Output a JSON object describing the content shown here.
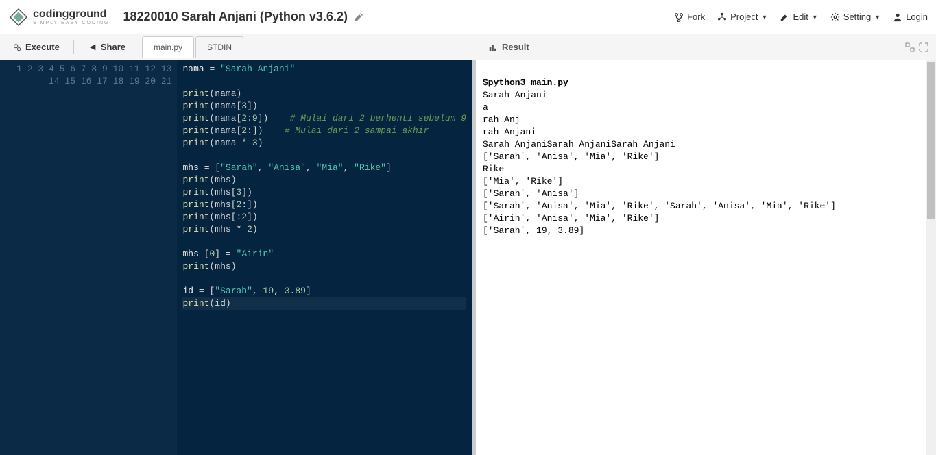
{
  "header": {
    "logo_main": "codingground",
    "logo_sub": "SIMPLY EASY CODING",
    "title": "18220010 Sarah Anjani (Python v3.6.2)"
  },
  "menu": {
    "fork": "Fork",
    "project": "Project",
    "edit": "Edit",
    "setting": "Setting",
    "login": "Login"
  },
  "toolbar": {
    "execute": "Execute",
    "share": "Share",
    "tab_main": "main.py",
    "tab_stdin": "STDIN",
    "result": "Result"
  },
  "editor": {
    "lines": [
      1,
      2,
      3,
      4,
      5,
      6,
      7,
      8,
      9,
      10,
      11,
      12,
      13,
      14,
      15,
      16,
      17,
      18,
      19,
      20,
      21
    ]
  },
  "code_tokens": {
    "l1": {
      "a": "nama ",
      "b": "=",
      "c": " \"Sarah Anjani\""
    },
    "l3": {
      "a": "print",
      "b": "(nama)"
    },
    "l4": {
      "a": "print",
      "b": "(nama[",
      "c": "3",
      "d": "])"
    },
    "l5": {
      "a": "print",
      "b": "(nama[",
      "c": "2",
      "d": ":",
      "e": "9",
      "f": "])    ",
      "g": "# Mulai dari 2 berhenti sebelum 9"
    },
    "l6": {
      "a": "print",
      "b": "(nama[",
      "c": "2",
      "d": ":])    ",
      "g": "# Mulai dari 2 sampai akhir"
    },
    "l7": {
      "a": "print",
      "b": "(nama * ",
      "c": "3",
      "d": ")"
    },
    "l9": {
      "a": "mhs ",
      "b": "=",
      "c": " [",
      "d": "\"Sarah\"",
      "e": ", ",
      "f": "\"Anisa\"",
      "g": ", ",
      "h": "\"Mia\"",
      "i": ", ",
      "j": "\"Rike\"",
      "k": "]"
    },
    "l10": {
      "a": "print",
      "b": "(mhs)"
    },
    "l11": {
      "a": "print",
      "b": "(mhs[",
      "c": "3",
      "d": "])"
    },
    "l12": {
      "a": "print",
      "b": "(mhs[",
      "c": "2",
      "d": ":])"
    },
    "l13": {
      "a": "print",
      "b": "(mhs[:",
      "c": "2",
      "d": "])"
    },
    "l14": {
      "a": "print",
      "b": "(mhs * ",
      "c": "2",
      "d": ")"
    },
    "l16": {
      "a": "mhs [",
      "b": "0",
      "c": "] ",
      "d": "=",
      "e": " \"Airin\""
    },
    "l17": {
      "a": "print",
      "b": "(mhs)"
    },
    "l19": {
      "a": "id ",
      "b": "=",
      "c": " [",
      "d": "\"Sarah\"",
      "e": ", ",
      "f": "19",
      "g": ", ",
      "h": "3.89",
      "i": "]"
    },
    "l20": {
      "a": "print",
      "b": "(id)"
    }
  },
  "console": {
    "cmd": "$python3 main.py",
    "out": "Sarah Anjani\na\nrah Anj\nrah Anjani\nSarah AnjaniSarah AnjaniSarah Anjani\n['Sarah', 'Anisa', 'Mia', 'Rike']\nRike\n['Mia', 'Rike']\n['Sarah', 'Anisa']\n['Sarah', 'Anisa', 'Mia', 'Rike', 'Sarah', 'Anisa', 'Mia', 'Rike']\n['Airin', 'Anisa', 'Mia', 'Rike']\n['Sarah', 19, 3.89]"
  }
}
